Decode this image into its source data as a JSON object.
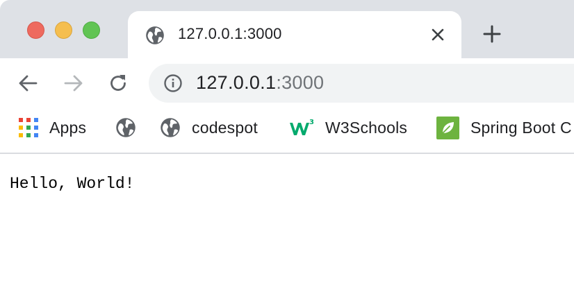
{
  "browser": {
    "tab": {
      "title": "127.0.0.1:3000",
      "favicon": "globe-icon"
    },
    "address_bar": {
      "host": "127.0.0.1",
      "port": ":3000",
      "security_icon": "info-icon"
    },
    "bookmarks": [
      {
        "label": "Apps",
        "icon": "apps-grid-icon"
      },
      {
        "label": "",
        "icon": "globe-icon"
      },
      {
        "label": "codespot",
        "icon": "globe-icon"
      },
      {
        "label": "W3Schools",
        "icon": "w3schools-icon"
      },
      {
        "label": "Spring Boot C",
        "icon": "spring-leaf-icon"
      }
    ],
    "colors": {
      "close": "#ee6a5f",
      "minimize": "#f5be4f",
      "zoom": "#61c454",
      "tabstrip": "#dee1e6",
      "omnibox": "#f1f3f4",
      "w3schools": "#04aa6d",
      "spring": "#6db33f"
    }
  },
  "page": {
    "body_text": "Hello, World!"
  }
}
